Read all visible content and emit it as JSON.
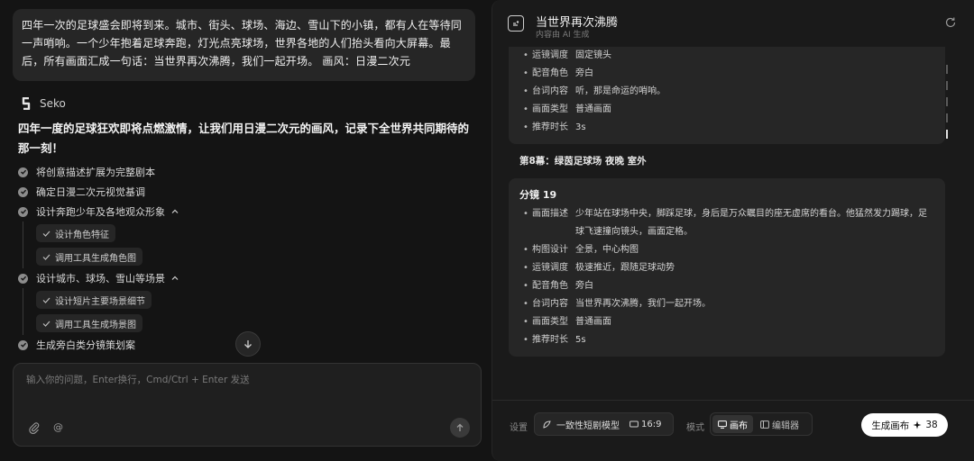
{
  "chat": {
    "user_message": "四年一次的足球盛会即将到来。城市、街头、球场、海边、雪山下的小镇，都有人在等待同一声哨响。一个少年抱着足球奔跑，灯光点亮球场，世界各地的人们抬头看向大屏幕。最后，所有画面汇成一句话：当世界再次沸腾，我们一起开场。 画风：日漫二次元",
    "assistant_name": "Seko",
    "assistant_intro": "四年一度的足球狂欢即将点燃激情，让我们用日漫二次元的画风，记录下全世界共同期待的那一刻！",
    "steps": [
      {
        "label": "将创意描述扩展为完整剧本"
      },
      {
        "label": "确定日漫二次元视觉基调"
      },
      {
        "label": "设计奔跑少年及各地观众形象",
        "substeps": [
          "设计角色特征",
          "调用工具生成角色图"
        ]
      },
      {
        "label": "设计城市、球场、雪山等场景",
        "substeps": [
          "设计短片主要场景细节",
          "调用工具生成场景图"
        ]
      },
      {
        "label": "生成旁白类分镜策划案"
      }
    ],
    "input_placeholder": "输入你的问题，Enter换行，Cmd/Ctrl + Enter 发送",
    "at_symbol": "@"
  },
  "panel": {
    "title": "当世界再次沸腾",
    "subtitle": "内容由 AI 生成",
    "prev_card": [
      {
        "key": "运镜调度",
        "value": "固定镜头"
      },
      {
        "key": "配音角色",
        "value": "旁白"
      },
      {
        "key": "台词内容",
        "value": "听，那是命运的哨响。"
      },
      {
        "key": "画面类型",
        "value": "普通画面"
      },
      {
        "key": "推荐时长",
        "value": "3s"
      }
    ],
    "scene_heading": "第8幕：绿茵足球场 夜晚 室外",
    "shot": {
      "title": "分镜 19",
      "rows": [
        {
          "key": "画面描述",
          "value": "少年站在球场中央，脚踩足球，身后是万众瞩目的座无虚席的看台。他猛然发力踢球，足球飞速撞向镜头，画面定格。"
        },
        {
          "key": "构图设计",
          "value": "全景，中心构图"
        },
        {
          "key": "运镜调度",
          "value": "极速推近，跟随足球动势"
        },
        {
          "key": "配音角色",
          "value": "旁白"
        },
        {
          "key": "台词内容",
          "value": "当世界再次沸腾，我们一起开场。"
        },
        {
          "key": "画面类型",
          "value": "普通画面"
        },
        {
          "key": "推荐时长",
          "value": "5s"
        }
      ]
    },
    "footer": {
      "settings_label": "设置",
      "model_name": "一致性短剧模型",
      "ratio": "16:9",
      "mode_label": "模式",
      "mode_canvas": "画布",
      "mode_editor": "编辑器",
      "generate_label": "生成画布",
      "generate_cost": "38"
    }
  }
}
